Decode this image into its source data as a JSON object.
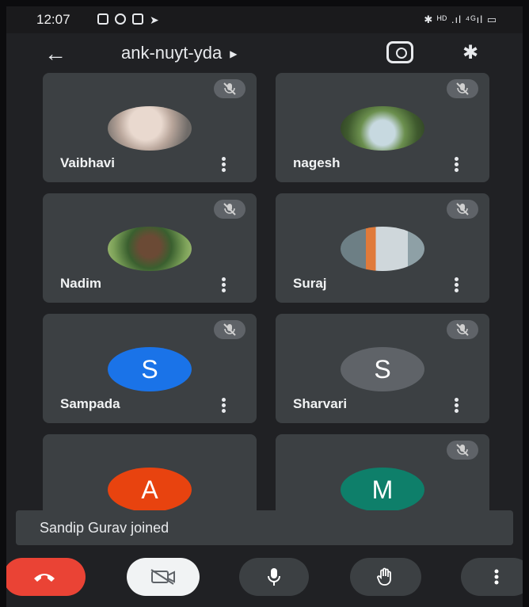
{
  "status_bar": {
    "time": "12:07",
    "right": "✱ ᴴᴰ .ıl ⁴ᴳıl ▭"
  },
  "header": {
    "title": "ank-nuyt-yda"
  },
  "participants": [
    {
      "name": "Vaibhavi",
      "avatar_type": "photo"
    },
    {
      "name": "nagesh",
      "avatar_type": "photo"
    },
    {
      "name": "Nadim",
      "avatar_type": "photo"
    },
    {
      "name": "Suraj",
      "avatar_type": "photo"
    },
    {
      "name": "Sampada",
      "avatar_type": "initial",
      "initial": "S",
      "color": "#1a73e8"
    },
    {
      "name": "Sharvari",
      "avatar_type": "initial",
      "initial": "S",
      "color": "#5f6368"
    },
    {
      "name": "",
      "avatar_type": "initial",
      "initial": "A",
      "color": "#e8430f"
    },
    {
      "name": "",
      "avatar_type": "initial",
      "initial": "M",
      "color": "#0e7f6a"
    }
  ],
  "toast": {
    "text": "Sandip Gurav joined"
  },
  "colors": {
    "end_call": "#ea4335",
    "surface": "#202124",
    "tile": "#3c4043"
  }
}
